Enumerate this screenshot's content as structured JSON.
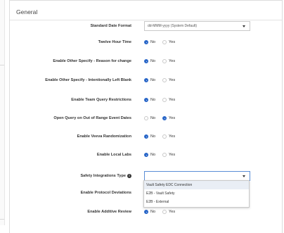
{
  "section": {
    "title": "General"
  },
  "fields": {
    "date_format": {
      "label": "Standard Date Format",
      "value": "dd-MMM-yyyy (System Default)"
    },
    "twelve_hour": {
      "label": "Twelve Hour Time",
      "no": "No",
      "yes": "Yes",
      "selected": "No"
    },
    "other_specify_reason": {
      "label": "Enable Other Specify - Reason for change",
      "no": "No",
      "yes": "Yes",
      "selected": "No"
    },
    "other_specify_blank": {
      "label": "Enable Other Specify - Intentionally Left Blank",
      "no": "No",
      "yes": "Yes",
      "selected": "No"
    },
    "team_query": {
      "label": "Enable Team Query Restrictions",
      "no": "No",
      "yes": "Yes",
      "selected": "No"
    },
    "open_query": {
      "label": "Open Query on Out of Range Event Dates",
      "no": "No",
      "yes": "Yes",
      "selected": "Yes"
    },
    "vault_randomization": {
      "label": "Enable Veeva Randomization",
      "no": "No",
      "yes": "Yes",
      "selected": "No"
    },
    "local_labs": {
      "label": "Enable Local Labs",
      "no": "No",
      "yes": "Yes",
      "selected": "No"
    },
    "safety_integrations": {
      "label": "Safety Integrations Type",
      "value": "",
      "options": [
        "Vault Safety EDC Connection",
        "E2B - Vault Safety",
        "E2B - External"
      ]
    },
    "protocol_deviations": {
      "label": "Enable Protocol Deviations"
    },
    "additive_review": {
      "label": "Enable Additive Review",
      "no": "No",
      "yes": "Yes",
      "selected": "No"
    }
  },
  "colors": {
    "accent": "#2a67c8"
  }
}
